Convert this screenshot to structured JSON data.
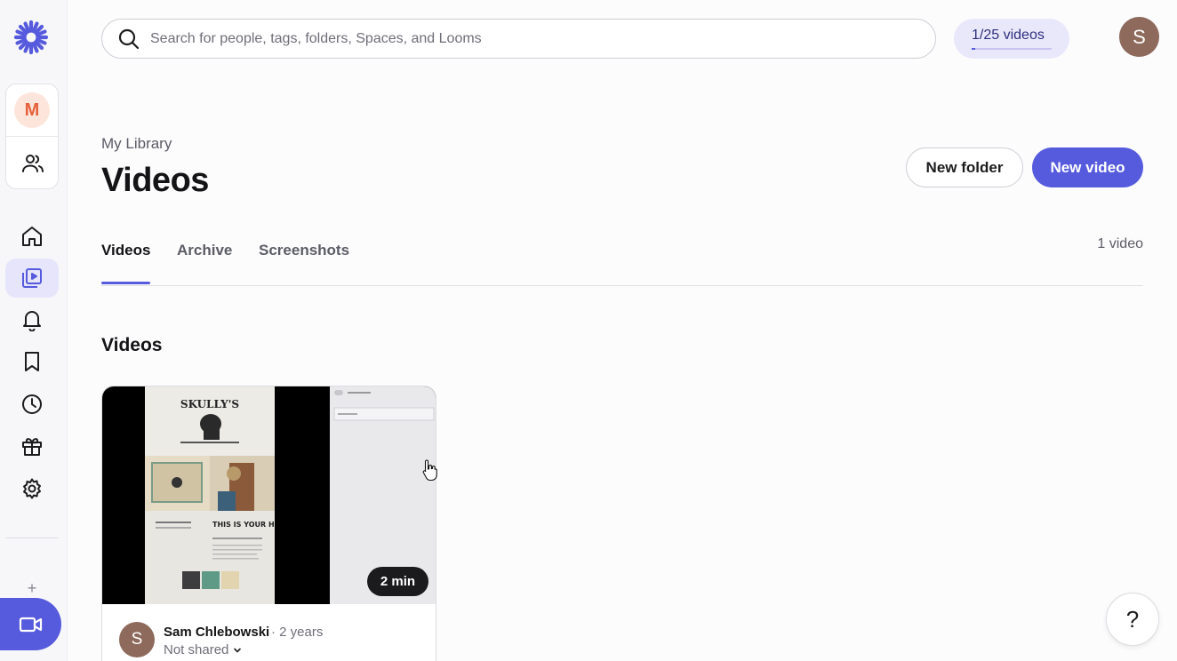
{
  "brand": {
    "accent": "#565add",
    "accent_light": "#e6e5fb",
    "workspace_color": "#e5603b"
  },
  "sidebar": {
    "workspace_initial": "M",
    "items": [
      {
        "icon": "home-icon"
      },
      {
        "icon": "library-icon",
        "active": true
      },
      {
        "icon": "bell-icon"
      },
      {
        "icon": "bookmark-icon"
      },
      {
        "icon": "clock-icon"
      },
      {
        "icon": "gift-icon"
      },
      {
        "icon": "gear-icon"
      }
    ],
    "record_icon": "camera-icon"
  },
  "search": {
    "placeholder": "Search for people, tags, folders, Spaces, and Looms",
    "value": ""
  },
  "quota": {
    "label": "1/25 videos",
    "used": 1,
    "total": 25
  },
  "user": {
    "initial": "S"
  },
  "header": {
    "breadcrumb": "My Library",
    "title": "Videos",
    "new_folder_label": "New folder",
    "new_video_label": "New video"
  },
  "tabs": [
    {
      "label": "Videos",
      "active": true
    },
    {
      "label": "Archive",
      "active": false
    },
    {
      "label": "Screenshots",
      "active": false
    }
  ],
  "video_count": "1 video",
  "section_title": "Videos",
  "videos": [
    {
      "duration": "2 min",
      "owner_initial": "S",
      "owner": "Sam Chlebowski",
      "age": "· 2 years",
      "sharing": "Not shared",
      "thumbnail_text": {
        "brand": "SKULLY'S",
        "heading": "THIS IS YOUR HEADING"
      }
    }
  ],
  "help_label": "?"
}
